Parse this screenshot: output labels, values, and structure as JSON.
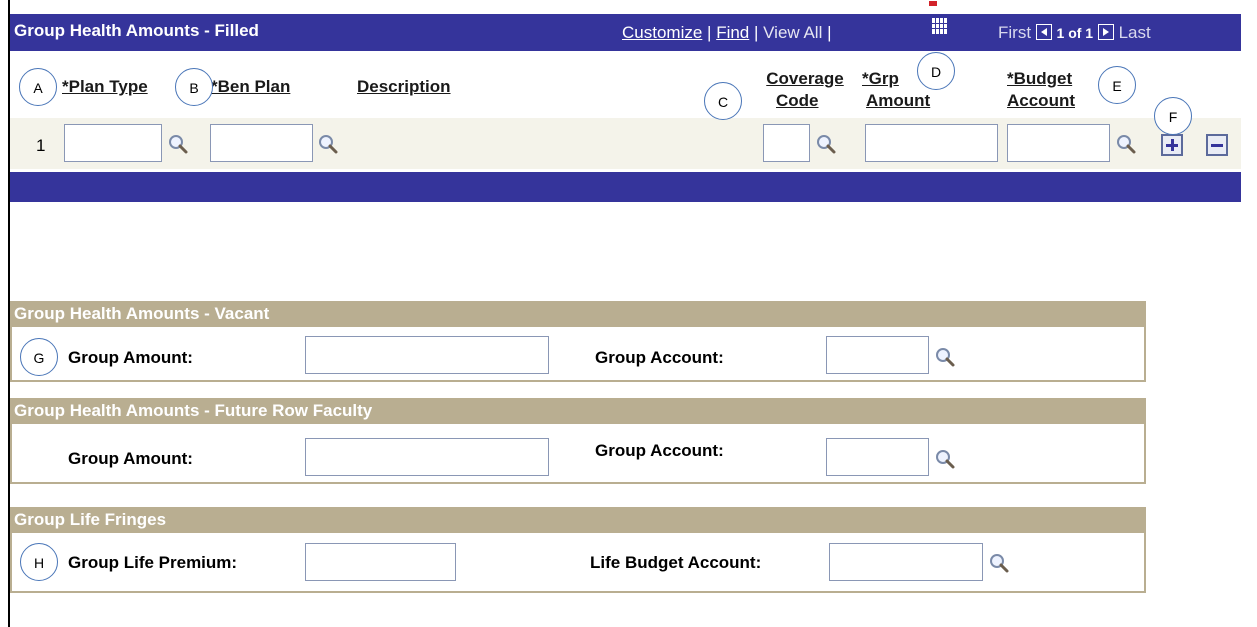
{
  "grid": {
    "title": "Group Health Amounts - Filled",
    "customize": "Customize",
    "sep1": " | ",
    "find": "Find",
    "sep2": " | ",
    "view_all": "View All",
    "sep3": " |",
    "first": "First",
    "count": "1 of 1",
    "last": "Last",
    "columns": {
      "plan_type": "*Plan Type",
      "ben_plan": "*Ben Plan",
      "description": "Description",
      "coverage_line1": "Coverage",
      "coverage_line2": "Code",
      "grp_line1": "*Grp",
      "grp_line2": "Amount",
      "budget_line1": "*Budget",
      "budget_line2": "Account"
    },
    "row_number": "1"
  },
  "markers": {
    "a": "A",
    "b": "B",
    "c": "C",
    "d": "D",
    "e": "E",
    "f": "F",
    "g": "G",
    "h": "H"
  },
  "vacant": {
    "title": "Group Health Amounts - Vacant",
    "group_amount_label": "Group Amount:",
    "group_account_label": "Group Account:"
  },
  "future": {
    "title": "Group Health Amounts - Future Row Faculty",
    "group_amount_label": "Group Amount:",
    "group_account_label": "Group Account:"
  },
  "life": {
    "title": "Group Life Fringes",
    "premium_label": "Group Life Premium:",
    "budget_label": "Life Budget Account:"
  },
  "colors": {
    "header_blue": "#35349b",
    "section_tan": "#b9ae91",
    "row_band": "#f4f3ea"
  }
}
